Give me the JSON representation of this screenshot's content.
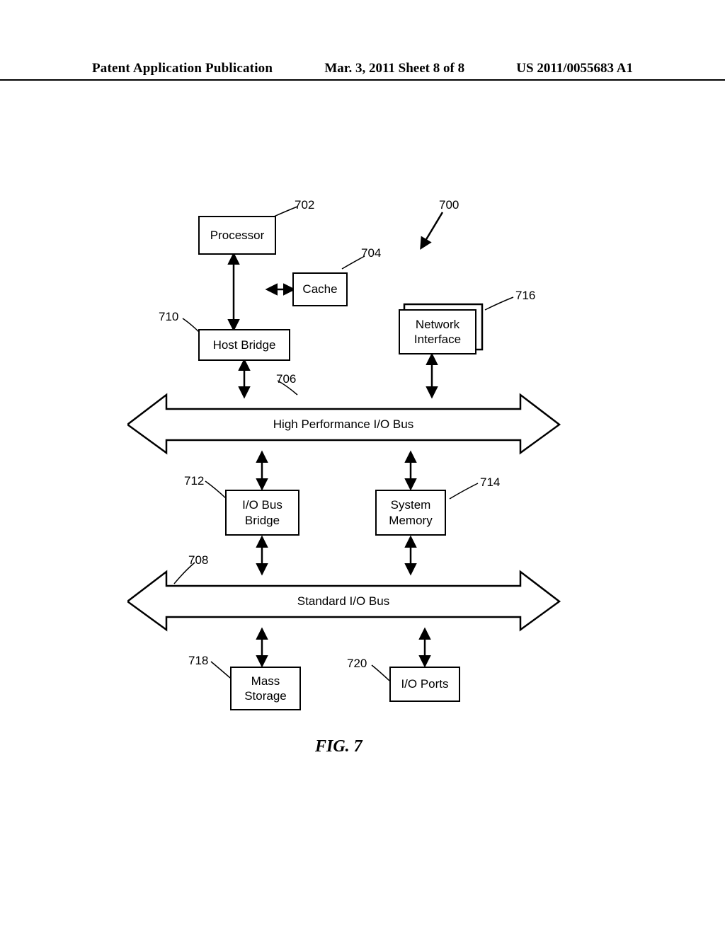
{
  "header": {
    "left": "Patent Application Publication",
    "mid": "Mar. 3, 2011  Sheet 8 of 8",
    "right": "US 2011/0055683 A1"
  },
  "refs": {
    "r700": "700",
    "r702": "702",
    "r704": "704",
    "r706": "706",
    "r708": "708",
    "r710": "710",
    "r712": "712",
    "r714": "714",
    "r716": "716",
    "r718": "718",
    "r720": "720"
  },
  "boxes": {
    "processor": "Processor",
    "cache": "Cache",
    "network_if": "Network\nInterface",
    "host_bridge": "Host Bridge",
    "bus_hp": "High Performance I/O Bus",
    "io_bus_bridge": "I/O Bus\nBridge",
    "sys_memory": "System\nMemory",
    "bus_std": "Standard I/O Bus",
    "mass_storage": "Mass\nStorage",
    "io_ports": "I/O Ports"
  },
  "figure_caption": "FIG. 7"
}
